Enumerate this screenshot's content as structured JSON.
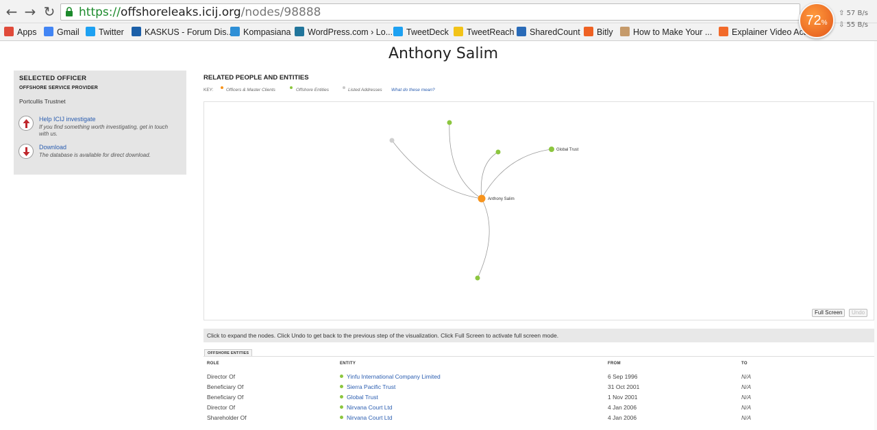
{
  "browser": {
    "url_scheme": "https://",
    "url_host": "offshoreleaks.icij.org",
    "url_path": "/nodes/98888",
    "speed_percent": "72",
    "speed_unit": "%",
    "up_rate": "57 B/s",
    "down_rate": "55 B/s"
  },
  "bookmarks": [
    {
      "label": "Apps",
      "icon": "apps-grid-icon",
      "color": "#e04a3a"
    },
    {
      "label": "Gmail",
      "icon": "google-icon",
      "color": "#4285f4"
    },
    {
      "label": "Twitter",
      "icon": "twitter-bird-icon",
      "color": "#1da1f2"
    },
    {
      "label": "KASKUS - Forum Dis...",
      "icon": "kaskus-icon",
      "color": "#1b5fa8"
    },
    {
      "label": "Kompasiana",
      "icon": "kompasiana-icon",
      "color": "#2e8fd6"
    },
    {
      "label": "WordPress.com › Lo...",
      "icon": "wordpress-icon",
      "color": "#21759b"
    },
    {
      "label": "TweetDeck",
      "icon": "tweetdeck-icon",
      "color": "#1da1f2"
    },
    {
      "label": "TweetReach",
      "icon": "tweetreach-icon",
      "color": "#f2c318"
    },
    {
      "label": "SharedCount",
      "icon": "sharedcount-icon",
      "color": "#2a6bb8"
    },
    {
      "label": "Bitly",
      "icon": "bitly-icon",
      "color": "#ee6123"
    },
    {
      "label": "How to Make Your ...",
      "icon": "face-icon",
      "color": "#c59a6a"
    },
    {
      "label": "Explainer Video Aca...",
      "icon": "video-icon",
      "color": "#f26a2a"
    }
  ],
  "page": {
    "title": "Anthony Salim"
  },
  "officer_panel": {
    "heading": "SELECTED OFFICER",
    "provider_heading": "OFFSHORE SERVICE PROVIDER",
    "provider_value": "Portcullis Trustnet",
    "help_title": "Help ICIJ investigate",
    "help_desc": "If you find something worth investigating, get in touch with us.",
    "download_title": "Download",
    "download_desc": "The database is available for direct download."
  },
  "related": {
    "heading": "RELATED PEOPLE AND ENTITIES",
    "key_label": "KEY:",
    "key_items": [
      {
        "label": "Officers & Master Clients",
        "color": "#f7941d"
      },
      {
        "label": "Offshore Entities",
        "color": "#8cc63f"
      },
      {
        "label": "Listed Addresses",
        "color": "#c8c8c8"
      }
    ],
    "key_link": "What do these mean?",
    "full_screen": "Full Screen",
    "undo": "Undo",
    "hint": "Click to expand the nodes. Click Undo to get back to the previous step of the visualization. Click Full Screen to activate full screen mode."
  },
  "graph": {
    "center_label": "Anthony Salim",
    "global_trust_label": "Global Trust"
  },
  "table": {
    "tab": "OFFSHORE ENTITIES",
    "headers": [
      "ROLE",
      "ENTITY",
      "FROM",
      "TO"
    ],
    "rows": [
      {
        "role": "Director Of",
        "entity": "Yinfu International Company Limited",
        "from": "6 Sep 1996",
        "to": "N/A"
      },
      {
        "role": "Beneficiary Of",
        "entity": "Sierra Pacific Trust",
        "from": "31 Oct 2001",
        "to": "N/A"
      },
      {
        "role": "Beneficiary Of",
        "entity": "Global Trust",
        "from": "1 Nov 2001",
        "to": "N/A"
      },
      {
        "role": "Director Of",
        "entity": "Nirvana Court Ltd",
        "from": "4 Jan 2006",
        "to": "N/A"
      },
      {
        "role": "Shareholder Of",
        "entity": "Nirvana Court Ltd",
        "from": "4 Jan 2006",
        "to": "N/A"
      }
    ]
  }
}
